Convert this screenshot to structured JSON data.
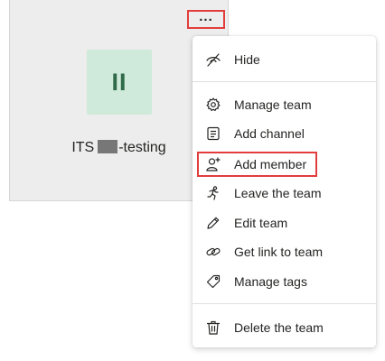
{
  "team_card": {
    "avatar_initials": "II",
    "name_prefix": "ITS",
    "name_suffix": "-testing",
    "more_options_label": "..."
  },
  "menu": {
    "items": [
      {
        "label": "Hide",
        "icon": "eye-off-icon"
      },
      {
        "label": "Manage team",
        "icon": "gear-icon"
      },
      {
        "label": "Add channel",
        "icon": "channel-list-icon"
      },
      {
        "label": "Add member",
        "icon": "add-person-icon"
      },
      {
        "label": "Leave the team",
        "icon": "person-running-icon"
      },
      {
        "label": "Edit team",
        "icon": "pencil-icon"
      },
      {
        "label": "Get link to team",
        "icon": "link-icon"
      },
      {
        "label": "Manage tags",
        "icon": "tag-icon"
      },
      {
        "label": "Delete the team",
        "icon": "trash-icon"
      }
    ]
  },
  "colors": {
    "highlight_border": "#e23d3d",
    "avatar_bg": "#cfe9da",
    "avatar_text": "#2f6b48",
    "card_bg": "#ededed"
  }
}
